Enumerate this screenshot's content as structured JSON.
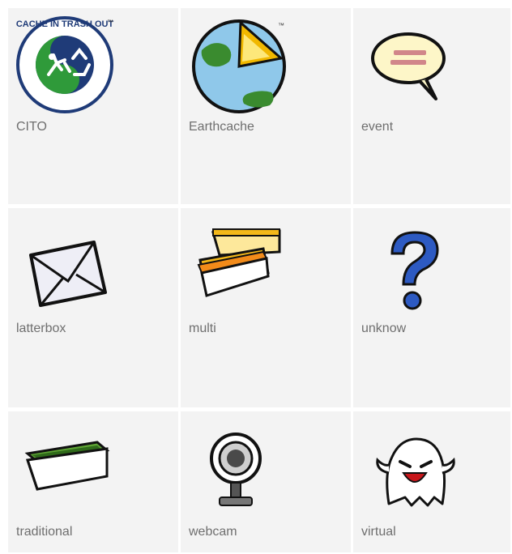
{
  "cache_types": [
    {
      "label": "CITO",
      "icon": "cito-icon",
      "logo_text": "CACHE IN TRASH OUT",
      "trademark": "™"
    },
    {
      "label": "Earthcache",
      "icon": "earthcache-icon",
      "trademark": "™"
    },
    {
      "label": "event",
      "icon": "event-icon"
    },
    {
      "label": "latterbox",
      "icon": "letterbox-icon"
    },
    {
      "label": "multi",
      "icon": "multi-icon"
    },
    {
      "label": "unknow",
      "icon": "unknown-icon"
    },
    {
      "label": "traditional",
      "icon": "traditional-icon"
    },
    {
      "label": "webcam",
      "icon": "webcam-icon"
    },
    {
      "label": "virtual",
      "icon": "virtual-icon"
    }
  ],
  "colors": {
    "tile_bg": "#f3f3f3",
    "label_text": "#6f6f6f"
  }
}
